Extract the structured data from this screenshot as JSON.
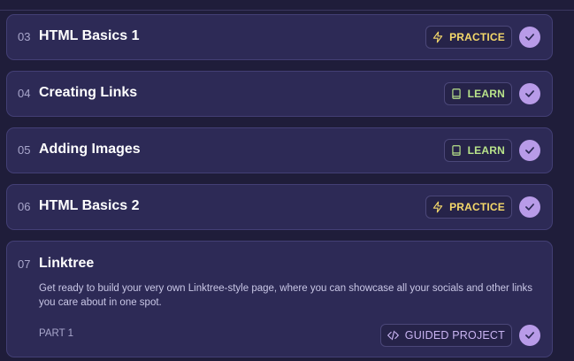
{
  "lessons": [
    {
      "number": "03",
      "title": "HTML Basics 1",
      "badge": "PRACTICE",
      "badge_type": "practice",
      "badge_icon": "lightning-icon"
    },
    {
      "number": "04",
      "title": "Creating Links",
      "badge": "LEARN",
      "badge_type": "learn",
      "badge_icon": "book-icon"
    },
    {
      "number": "05",
      "title": "Adding Images",
      "badge": "LEARN",
      "badge_type": "learn",
      "badge_icon": "book-icon"
    },
    {
      "number": "06",
      "title": "HTML Basics 2",
      "badge": "PRACTICE",
      "badge_type": "practice",
      "badge_icon": "lightning-icon"
    }
  ],
  "project": {
    "number": "07",
    "title": "Linktree",
    "description": "Get ready to build your very own Linktree-style page, where you can showcase all your socials and other links you care about in one spot.",
    "part": "PART 1",
    "badge": "GUIDED PROJECT",
    "badge_icon": "code-icon"
  },
  "colors": {
    "background": "#1f1d3a",
    "card": "#2d2a56",
    "practice": "#f4d86a",
    "learn": "#b8e38a",
    "guided": "#c9b4f2",
    "check": "#b89be8"
  }
}
